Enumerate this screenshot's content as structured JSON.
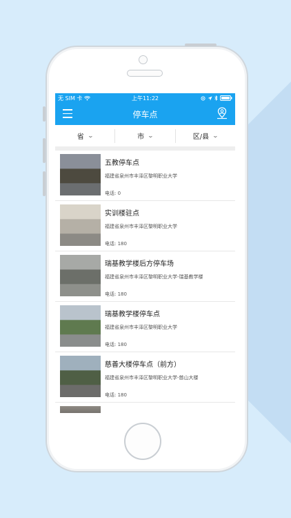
{
  "status_bar": {
    "carrier": "无 SIM 卡",
    "time": "上午11:22"
  },
  "navbar": {
    "title": "停车点"
  },
  "filters": [
    {
      "label": "省"
    },
    {
      "label": "市"
    },
    {
      "label": "区/县"
    }
  ],
  "parking_points": [
    {
      "name": "五教停车点",
      "address": "福建省泉州市丰泽区黎明职业大学",
      "phone": "电话: 0",
      "thumb_colors": [
        "#8a8f99",
        "#4d4a3f",
        "#6b6e70"
      ]
    },
    {
      "name": "实训楼驻点",
      "address": "福建省泉州市丰泽区黎明职业大学",
      "phone": "电话: 180",
      "thumb_colors": [
        "#d9d4c9",
        "#b5b0a6",
        "#8c8a85"
      ]
    },
    {
      "name": "瑞基教学楼后方停车场",
      "address": "福建省泉州市丰泽区黎明职业大学-瑞基教学楼",
      "phone": "电话: 180",
      "thumb_colors": [
        "#a7a9a6",
        "#6c6f69",
        "#8e908b"
      ]
    },
    {
      "name": "瑞基教学楼停车点",
      "address": "福建省泉州市丰泽区黎明职业大学",
      "phone": "电话: 180",
      "thumb_colors": [
        "#b9c3cc",
        "#5f7a4f",
        "#8a8d8c"
      ]
    },
    {
      "name": "慈善大楼停车点（前方）",
      "address": "福建省泉州市丰泽区黎明职业大学-慈山大楼",
      "phone": "电话: 180",
      "thumb_colors": [
        "#9fb0bd",
        "#4f5f45",
        "#6c6c6a"
      ]
    }
  ],
  "colors": {
    "accent": "#1aa3f0",
    "background": "#d7ecfb"
  }
}
